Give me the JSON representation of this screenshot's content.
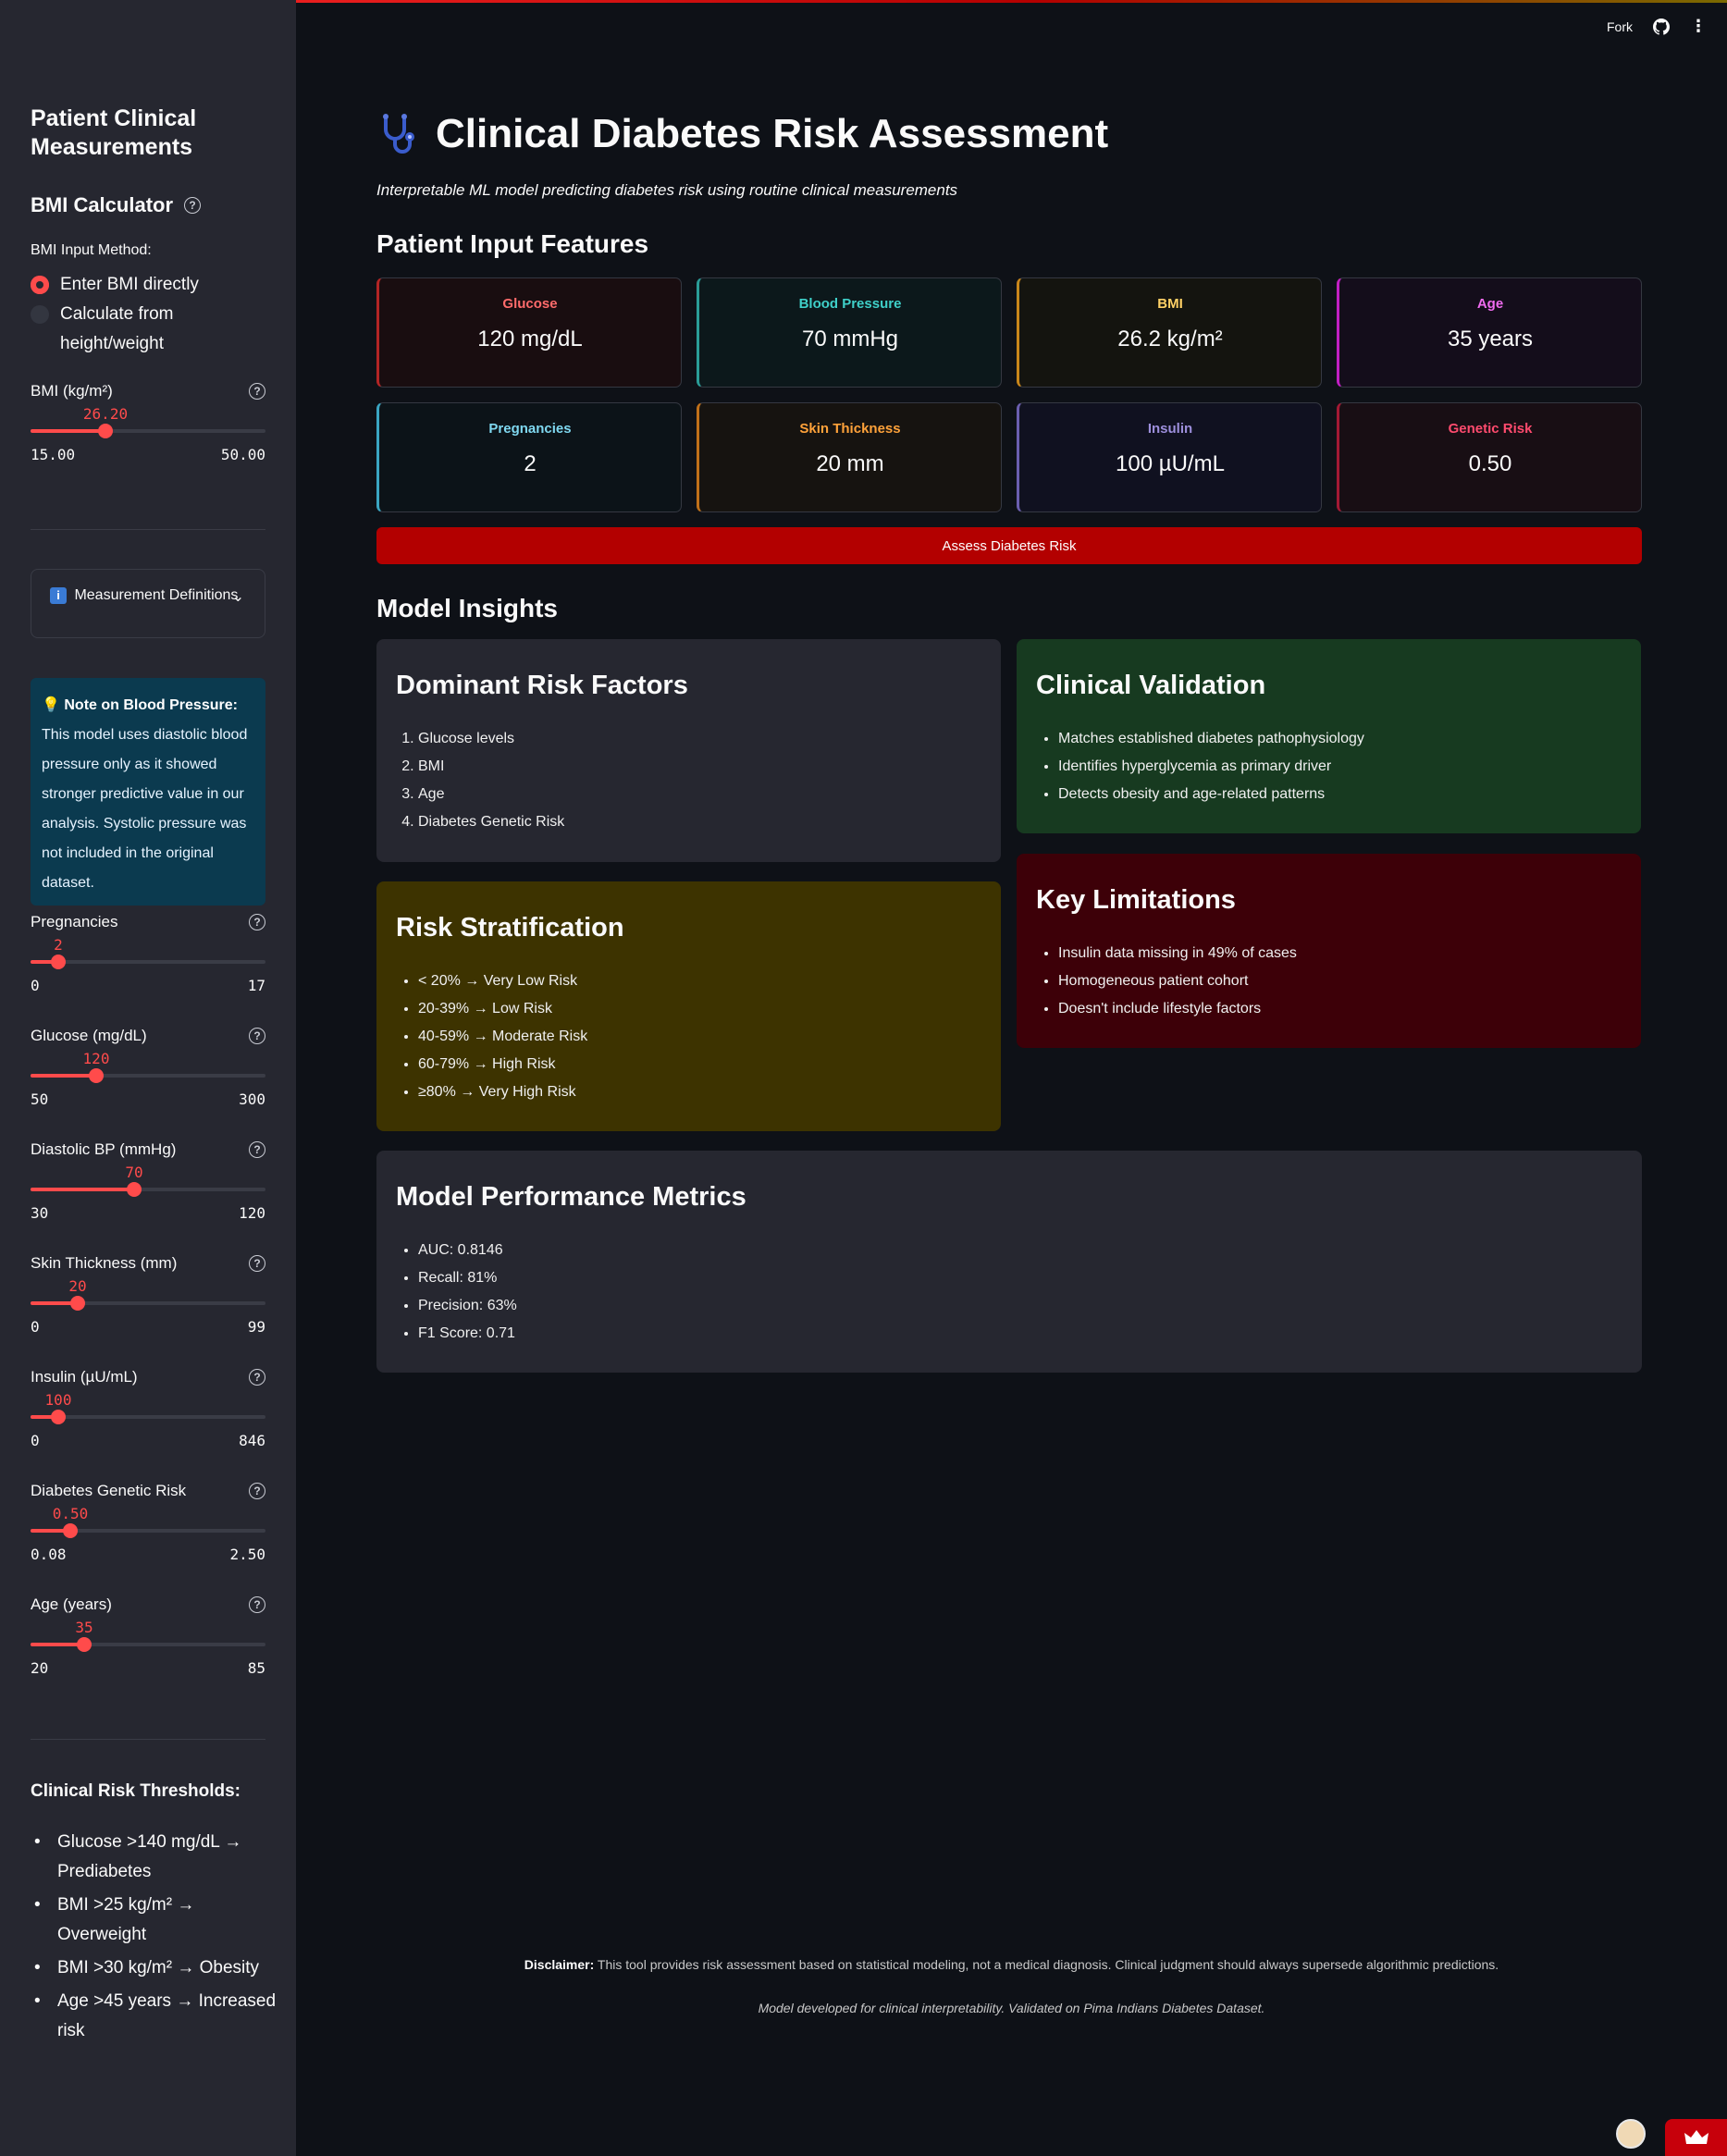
{
  "header": {
    "fork_label": "Fork"
  },
  "sidebar": {
    "title": "Patient Clinical Measurements",
    "bmi_section": "BMI Calculator",
    "bmi_method_label": "BMI Input Method:",
    "radio_options": [
      "Enter BMI directly",
      "Calculate from height/weight"
    ],
    "selected_option": "Enter BMI directly",
    "expander_label": "Measurement Definitions",
    "note_title": "Note on Blood Pressure:",
    "note_text": "This model uses diastolic blood pressure only as it showed stronger predictive value in our analysis. Systolic pressure was not included in the original dataset.",
    "sliders": [
      {
        "label": "BMI (kg/m²)",
        "value": "26.20",
        "min": "15.00",
        "max": "50.00",
        "fraction": 0.32
      },
      {
        "label": "Pregnancies",
        "value": "2",
        "min": "0",
        "max": "17",
        "fraction": 0.12
      },
      {
        "label": "Glucose (mg/dL)",
        "value": "120",
        "min": "50",
        "max": "300",
        "fraction": 0.28
      },
      {
        "label": "Diastolic BP (mmHg)",
        "value": "70",
        "min": "30",
        "max": "120",
        "fraction": 0.44
      },
      {
        "label": "Skin Thickness (mm)",
        "value": "20",
        "min": "0",
        "max": "99",
        "fraction": 0.2
      },
      {
        "label": "Insulin (µU/mL)",
        "value": "100",
        "min": "0",
        "max": "846",
        "fraction": 0.12
      },
      {
        "label": "Diabetes Genetic Risk",
        "value": "0.50",
        "min": "0.08",
        "max": "2.50",
        "fraction": 0.17
      },
      {
        "label": "Age (years)",
        "value": "35",
        "min": "20",
        "max": "85",
        "fraction": 0.23
      }
    ],
    "thresholds_title": "Clinical Risk Thresholds:",
    "thresholds": [
      "Glucose >140 mg/dL → Prediabetes",
      "BMI >25 kg/m² → Overweight",
      "BMI >30 kg/m² → Obesity",
      "Age >45 years → Increased risk"
    ]
  },
  "main": {
    "title": "Clinical Diabetes Risk Assessment",
    "subtitle": "Interpretable ML model predicting diabetes risk using routine clinical measurements",
    "features_heading": "Patient Input Features",
    "cards": [
      {
        "title": "Glucose",
        "value": "120 mg/dL",
        "color": "#ff6b6b",
        "border": "#b32525",
        "bg": "#190d10"
      },
      {
        "title": "Blood Pressure",
        "value": "70 mmHg",
        "color": "#3fd0c9",
        "border": "#2a9d98",
        "bg": "#0c181b"
      },
      {
        "title": "BMI",
        "value": "26.2 kg/m²",
        "color": "#ffd166",
        "border": "#c8861a",
        "bg": "#14140f"
      },
      {
        "title": "Age",
        "value": "35 years",
        "color": "#f06bf0",
        "border": "#c11fc4",
        "bg": "#140d1b"
      },
      {
        "title": "Pregnancies",
        "value": "2",
        "color": "#7fd8f0",
        "border": "#3aa5c2",
        "bg": "#0c1318"
      },
      {
        "title": "Skin Thickness",
        "value": "20 mm",
        "color": "#ffa23a",
        "border": "#c07019",
        "bg": "#161310"
      },
      {
        "title": "Insulin",
        "value": "100 µU/mL",
        "color": "#9d8fdc",
        "border": "#6b5fb0",
        "bg": "#101120"
      },
      {
        "title": "Genetic Risk",
        "value": "0.50",
        "color": "#ff4b6e",
        "border": "#a31934",
        "bg": "#180e14"
      }
    ],
    "assess_button": "Assess Diabetes Risk",
    "insights_heading": "Model Insights",
    "dominant": {
      "title": "Dominant Risk Factors",
      "items": [
        "Glucose levels",
        "BMI",
        "Age",
        "Diabetes Genetic Risk"
      ]
    },
    "validation": {
      "title": "Clinical Validation",
      "items": [
        "Matches established diabetes pathophysiology",
        "Identifies hyperglycemia as primary driver",
        "Detects obesity and age-related patterns"
      ]
    },
    "stratification": {
      "title": "Risk Stratification",
      "items": [
        "< 20% → Very Low Risk",
        "20-39% → Low Risk",
        "40-59% → Moderate Risk",
        "60-79% → High Risk",
        "≥80% → Very High Risk"
      ]
    },
    "limitations": {
      "title": "Key Limitations",
      "items": [
        "Insulin data missing in 49% of cases",
        "Homogeneous patient cohort",
        "Doesn't include lifestyle factors"
      ]
    },
    "performance": {
      "title": "Model Performance Metrics",
      "items": [
        "AUC: 0.8146",
        "Recall: 81%",
        "Precision: 63%",
        "F1 Score: 0.71"
      ]
    },
    "disclaimer_label": "Disclaimer:",
    "disclaimer_text": "This tool provides risk assessment based on statistical modeling, not a medical diagnosis. Clinical judgment should always supersede algorithmic predictions.",
    "credit": "Model developed for clinical interpretability. Validated on Pima Indians Diabetes Dataset."
  }
}
